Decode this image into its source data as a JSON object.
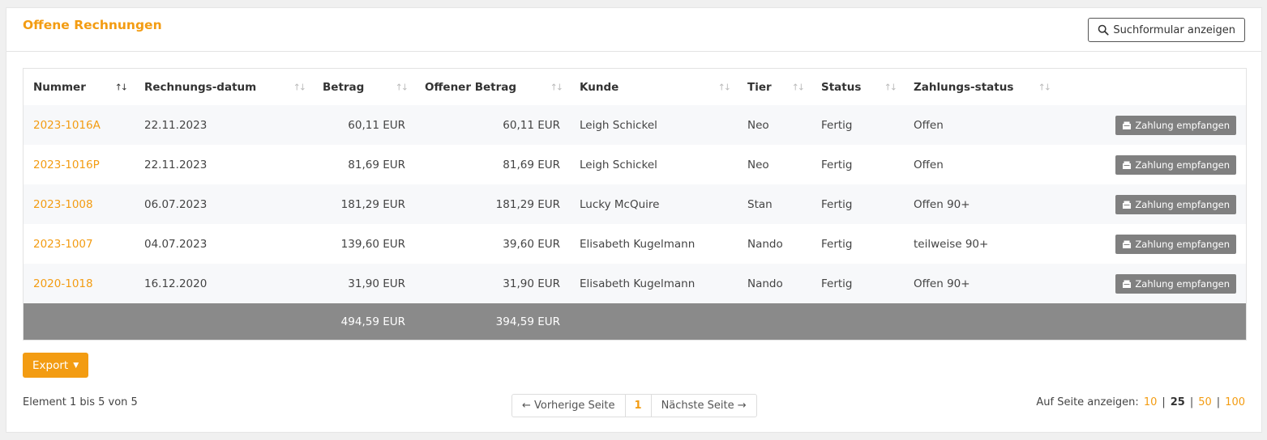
{
  "header": {
    "title": "Offene Rechnungen",
    "search_button": "Suchformular anzeigen"
  },
  "table": {
    "columns": [
      "Nummer",
      "Rechnungs-datum",
      "Betrag",
      "Offener Betrag",
      "Kunde",
      "Tier",
      "Status",
      "Zahlungs-status"
    ],
    "rows": [
      {
        "nummer": "2023-1016A",
        "datum": "22.11.2023",
        "betrag": "60,11 EUR",
        "offen": "60,11 EUR",
        "kunde": "Leigh Schickel",
        "tier": "Neo",
        "status": "Fertig",
        "zahlung": "Offen",
        "action": "Zahlung empfangen"
      },
      {
        "nummer": "2023-1016P",
        "datum": "22.11.2023",
        "betrag": "81,69 EUR",
        "offen": "81,69 EUR",
        "kunde": "Leigh Schickel",
        "tier": "Neo",
        "status": "Fertig",
        "zahlung": "Offen",
        "action": "Zahlung empfangen"
      },
      {
        "nummer": "2023-1008",
        "datum": "06.07.2023",
        "betrag": "181,29 EUR",
        "offen": "181,29 EUR",
        "kunde": "Lucky McQuire",
        "tier": "Stan",
        "status": "Fertig",
        "zahlung": "Offen 90+",
        "action": "Zahlung empfangen"
      },
      {
        "nummer": "2023-1007",
        "datum": "04.07.2023",
        "betrag": "139,60 EUR",
        "offen": "39,60 EUR",
        "kunde": "Elisabeth Kugelmann",
        "tier": "Nando",
        "status": "Fertig",
        "zahlung": "teilweise 90+",
        "action": "Zahlung empfangen"
      },
      {
        "nummer": "2020-1018",
        "datum": "16.12.2020",
        "betrag": "31,90 EUR",
        "offen": "31,90 EUR",
        "kunde": "Elisabeth Kugelmann",
        "tier": "Nando",
        "status": "Fertig",
        "zahlung": "Offen 90+",
        "action": "Zahlung empfangen"
      }
    ],
    "totals": {
      "betrag": "494,59 EUR",
      "offen": "394,59 EUR"
    }
  },
  "footer": {
    "export_label": "Export",
    "element_info": "Element 1 bis 5 von 5",
    "prev_label": "← Vorherige Seite",
    "current_page": "1",
    "next_label": "Nächste Seite →",
    "per_page_label": "Auf Seite anzeigen:",
    "per_page_options": [
      "10",
      "25",
      "50",
      "100"
    ],
    "per_page_selected": "25"
  },
  "colors": {
    "accent": "#f39c12",
    "totals_bg": "#8a8a8a",
    "action_btn": "#808080"
  }
}
